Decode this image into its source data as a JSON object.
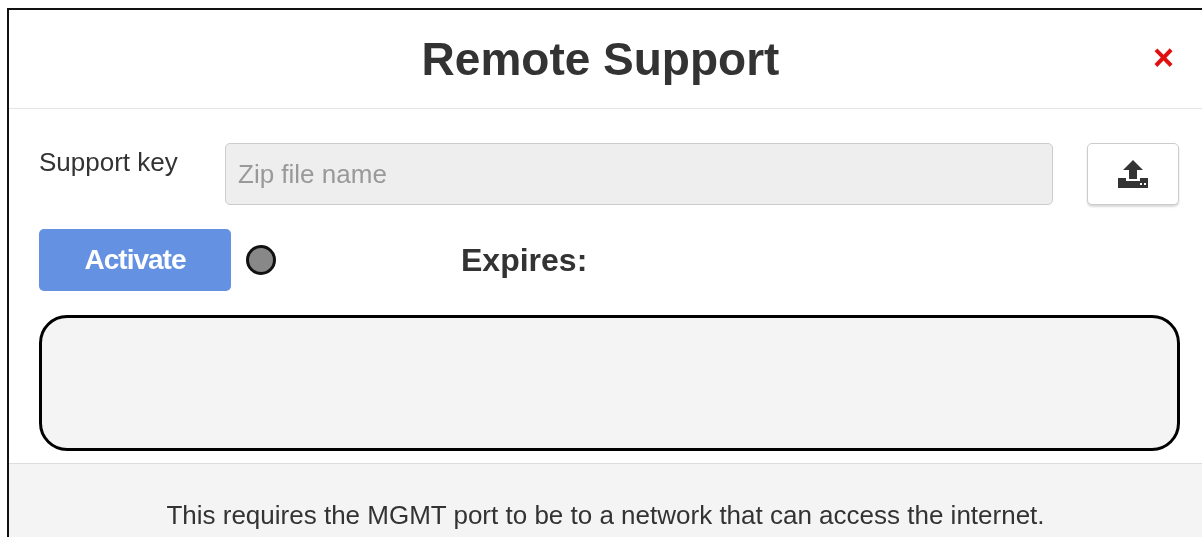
{
  "dialog": {
    "title": "Remote Support",
    "close": "×"
  },
  "support_key": {
    "label": "Support key",
    "placeholder": "Zip file name"
  },
  "activate_button": "Activate",
  "status": {
    "active": false
  },
  "expires_label": "Expires:",
  "footer_note": "This requires the MGMT port to be to a network that can access the internet."
}
